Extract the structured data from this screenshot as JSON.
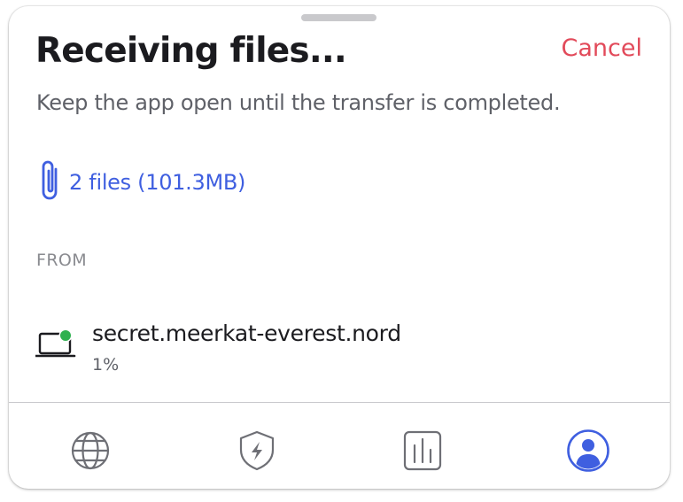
{
  "header": {
    "title": "Receiving files...",
    "cancel_label": "Cancel",
    "subtitle": "Keep the app open until the transfer is completed."
  },
  "files": {
    "icon": "paperclip-icon",
    "label": "2 files (101.3MB)"
  },
  "from": {
    "section_label": "FROM",
    "device_icon": "laptop-icon",
    "device_name": "secret.meerkat-everest.nord",
    "progress": "1%",
    "online_status_color": "#2fb14f"
  },
  "tabbar": {
    "tabs": [
      {
        "name": "globe-icon",
        "active": false
      },
      {
        "name": "shield-bolt-icon",
        "active": false
      },
      {
        "name": "chart-icon",
        "active": false
      },
      {
        "name": "profile-icon",
        "active": true
      }
    ],
    "active_color": "#3f5fe0",
    "inactive_color": "#6e6f75"
  },
  "colors": {
    "accent": "#3f5fe0",
    "cancel": "#e24a5a"
  }
}
